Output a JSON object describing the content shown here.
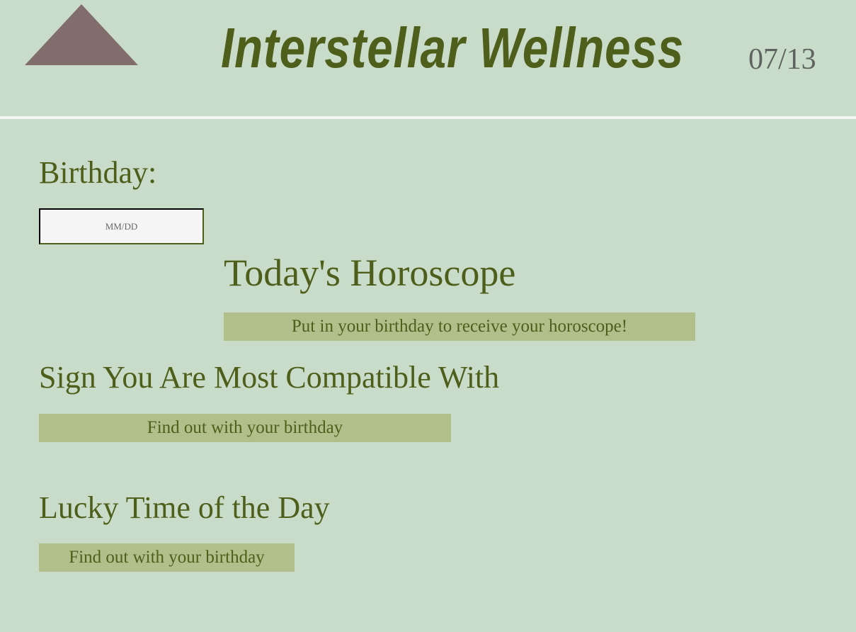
{
  "header": {
    "title": "Interstellar Wellness",
    "date": "07/13",
    "logo_icon": "triangle-icon"
  },
  "birthday": {
    "label": "Birthday:",
    "placeholder": "MM/DD",
    "value": ""
  },
  "horoscope": {
    "heading": "Today's Horoscope",
    "text": "Put in your birthday to receive your horoscope!"
  },
  "compatibility": {
    "heading": "Sign You Are Most Compatible With",
    "text": "Find out with your birthday"
  },
  "lucky_time": {
    "heading": "Lucky Time of the Day",
    "text": "Find out with your birthday"
  },
  "colors": {
    "background": "#c9dcc9",
    "accent": "#4e5e1b",
    "box": "#b1bf8b",
    "logo": "#816d6c"
  }
}
